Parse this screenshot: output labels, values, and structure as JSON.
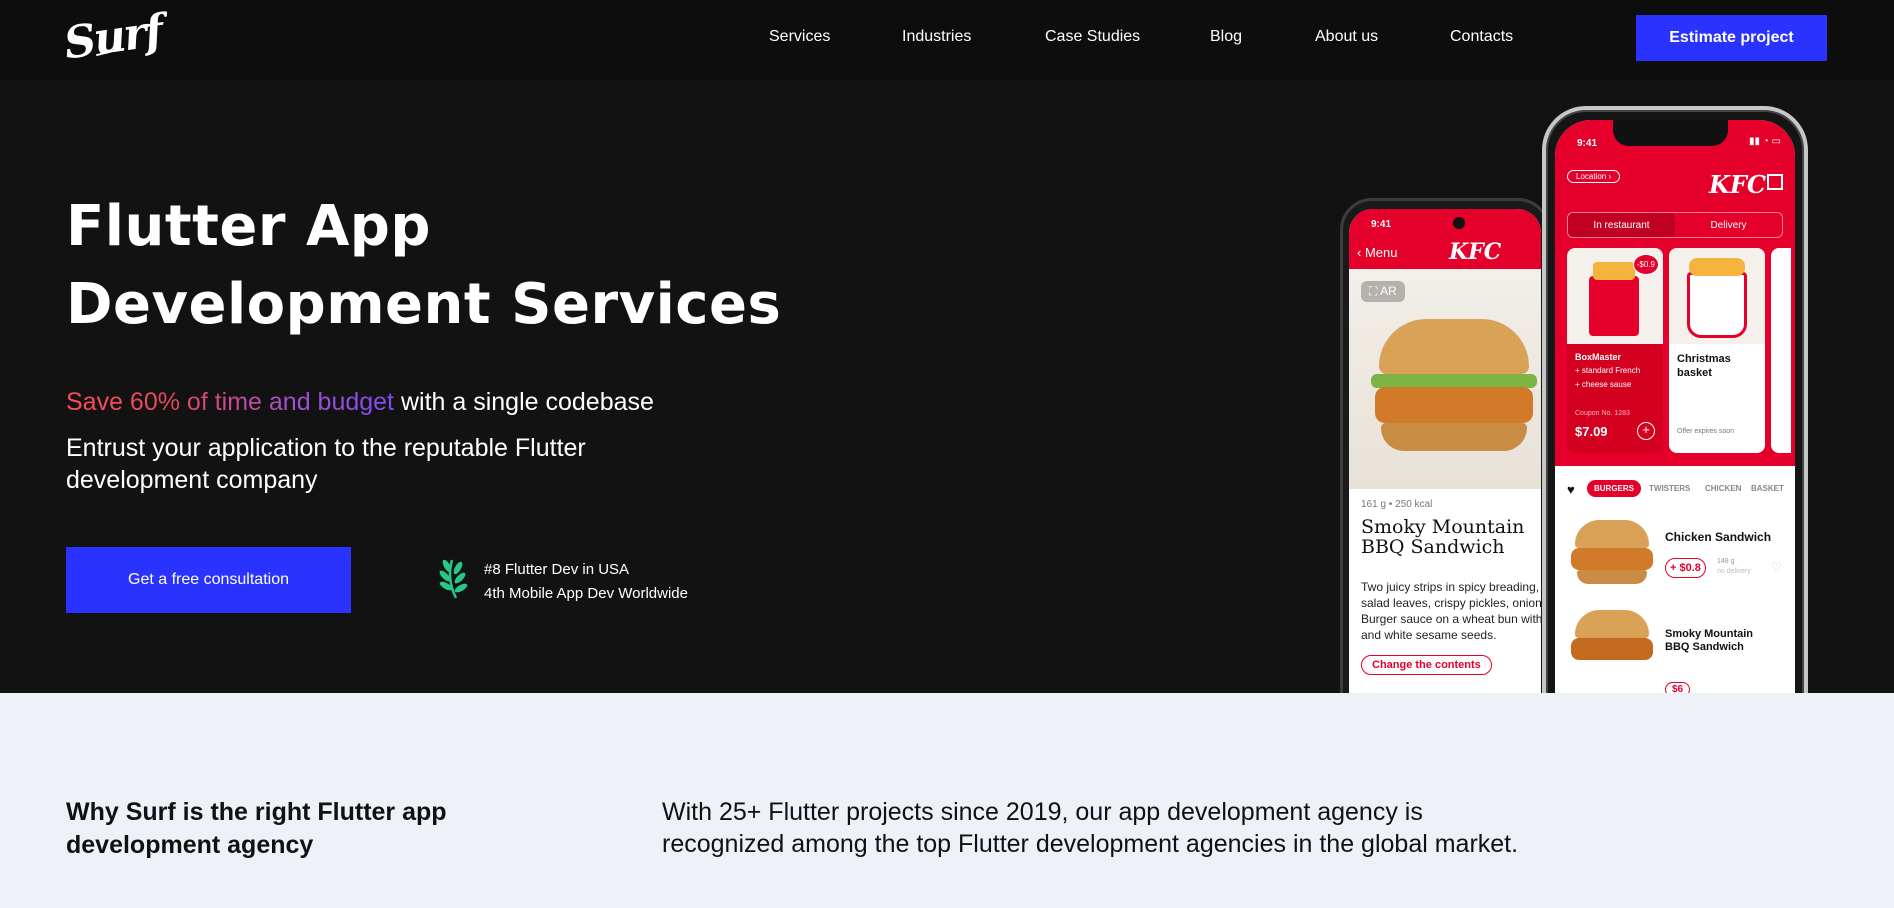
{
  "nav": {
    "logo": "Surf",
    "items": [
      "Services",
      "Industries",
      "Case Studies",
      "Blog",
      "About us",
      "Contacts"
    ],
    "cta": "Estimate project"
  },
  "hero": {
    "title_line1": "Flutter App",
    "title_line2": "Development Services",
    "tagline_highlight": "Save 60% of time and budget",
    "tagline_rest": " with a single codebase",
    "subtitle": "Entrust your application to the reputable Flutter development company",
    "button": "Get a free consultation",
    "rank_line1": "#8 Flutter Dev in USA",
    "rank_line2": "4th Mobile App Dev Worldwide"
  },
  "phone_back": {
    "time": "9:41",
    "back_label": "Menu",
    "brand": "KFC",
    "ar_badge": "AR",
    "meta": "161 g • 250 kcal",
    "product_title": "Smoky Mountain BBQ Sandwich",
    "description": "Two juicy strips in spicy breading, salad leaves, crispy pickles, onion, Burger sauce on a wheat bun with and white sesame seeds.",
    "change_button": "Change the contents"
  },
  "phone_front": {
    "time": "9:41",
    "location": "Location",
    "brand": "KFC",
    "tab_in": "In restaurant",
    "tab_delivery": "Delivery",
    "card1_discount": "-$0.9",
    "card1_title": "BoxMaster",
    "card1_line2": "+ standard French",
    "card1_line3": "+ cheese sause",
    "card1_coupon": "Coupon No. 1283",
    "card1_price": "$7.09",
    "card2_title": "Christmas basket",
    "card2_note": "Offer expires soon",
    "categories": [
      "BURGERS",
      "TWISTERS",
      "CHICKEN",
      "BASKET"
    ],
    "item1_title": "Chicken Sandwich",
    "item1_price": "+ $0.8",
    "item1_weight": "148 g",
    "item1_delivery": "no delivery",
    "item2_title": "Smoky Mountain BBQ Sandwich",
    "item2_price": "$6"
  },
  "why": {
    "title": "Why Surf is the right Flutter app development agency",
    "text": "With 25+ Flutter projects since 2019, our app development agency is recognized among the top Flutter development agencies in the global market."
  },
  "colors": {
    "accent": "#2a32ff",
    "kfc_red": "#e4002b",
    "hero_bg": "#121212",
    "section_bg": "#eef1f8"
  }
}
